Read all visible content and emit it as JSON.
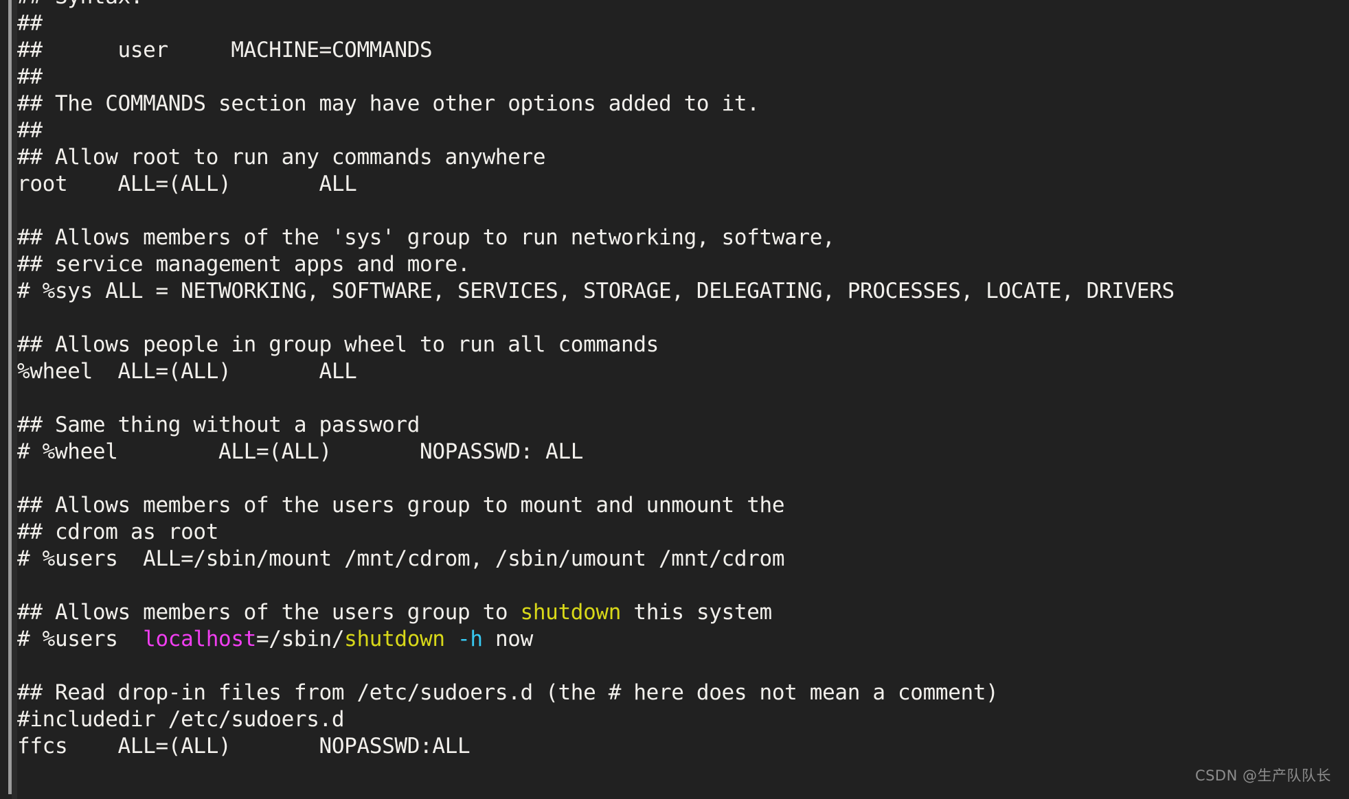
{
  "window": {
    "kind": "terminal-text-editor",
    "file_context": "/etc/sudoers",
    "background_color": "#212121",
    "foreground_color": "#f2f0ec"
  },
  "colors": {
    "default": "#f2f0ec",
    "keyword_yellow": "#d8d819",
    "host_magenta": "#f03ef0",
    "flag_cyan": "#37c9f2",
    "scrollbar": "#9b9b9b",
    "watermark": "#8d8d8d"
  },
  "editor": {
    "lines": [
      {
        "id": 1,
        "segments": [
          {
            "text": "## Syntax:",
            "color": "default"
          }
        ]
      },
      {
        "id": 2,
        "segments": [
          {
            "text": "##",
            "color": "default"
          }
        ]
      },
      {
        "id": 3,
        "segments": [
          {
            "text": "##      user     MACHINE=COMMANDS",
            "color": "default"
          }
        ]
      },
      {
        "id": 4,
        "segments": [
          {
            "text": "##",
            "color": "default"
          }
        ]
      },
      {
        "id": 5,
        "segments": [
          {
            "text": "## The COMMANDS section may have other options added to it.",
            "color": "default"
          }
        ]
      },
      {
        "id": 6,
        "segments": [
          {
            "text": "##",
            "color": "default"
          }
        ]
      },
      {
        "id": 7,
        "segments": [
          {
            "text": "## Allow root to run any commands anywhere",
            "color": "default"
          }
        ]
      },
      {
        "id": 8,
        "segments": [
          {
            "text": "root    ALL=(ALL)       ALL",
            "color": "default"
          }
        ]
      },
      {
        "id": 9,
        "segments": [
          {
            "text": "",
            "color": "default"
          }
        ]
      },
      {
        "id": 10,
        "segments": [
          {
            "text": "## Allows members of the 'sys' group to run networking, software,",
            "color": "default"
          }
        ]
      },
      {
        "id": 11,
        "segments": [
          {
            "text": "## service management apps and more.",
            "color": "default"
          }
        ]
      },
      {
        "id": 12,
        "segments": [
          {
            "text": "# %sys ALL = NETWORKING, SOFTWARE, SERVICES, STORAGE, DELEGATING, PROCESSES, LOCATE, DRIVERS",
            "color": "default"
          }
        ]
      },
      {
        "id": 13,
        "segments": [
          {
            "text": "",
            "color": "default"
          }
        ]
      },
      {
        "id": 14,
        "segments": [
          {
            "text": "## Allows people in group wheel to run all commands",
            "color": "default"
          }
        ]
      },
      {
        "id": 15,
        "segments": [
          {
            "text": "%wheel  ALL=(ALL)       ALL",
            "color": "default"
          }
        ]
      },
      {
        "id": 16,
        "segments": [
          {
            "text": "",
            "color": "default"
          }
        ]
      },
      {
        "id": 17,
        "segments": [
          {
            "text": "## Same thing without a password",
            "color": "default"
          }
        ]
      },
      {
        "id": 18,
        "segments": [
          {
            "text": "# %wheel        ALL=(ALL)       NOPASSWD: ALL",
            "color": "default"
          }
        ]
      },
      {
        "id": 19,
        "segments": [
          {
            "text": "",
            "color": "default"
          }
        ]
      },
      {
        "id": 20,
        "segments": [
          {
            "text": "## Allows members of the users group to mount and unmount the",
            "color": "default"
          }
        ]
      },
      {
        "id": 21,
        "segments": [
          {
            "text": "## cdrom as root",
            "color": "default"
          }
        ]
      },
      {
        "id": 22,
        "segments": [
          {
            "text": "# %users  ALL=/sbin/mount /mnt/cdrom, /sbin/umount /mnt/cdrom",
            "color": "default"
          }
        ]
      },
      {
        "id": 23,
        "segments": [
          {
            "text": "",
            "color": "default"
          }
        ]
      },
      {
        "id": 24,
        "segments": [
          {
            "text": "## Allows members of the users group to ",
            "color": "default"
          },
          {
            "text": "shutdown",
            "color": "keyword_yellow"
          },
          {
            "text": " this system",
            "color": "default"
          }
        ]
      },
      {
        "id": 25,
        "segments": [
          {
            "text": "# %users  ",
            "color": "default"
          },
          {
            "text": "localhost",
            "color": "host_magenta"
          },
          {
            "text": "=/sbin/",
            "color": "default"
          },
          {
            "text": "shutdown",
            "color": "keyword_yellow"
          },
          {
            "text": " ",
            "color": "default"
          },
          {
            "text": "-h",
            "color": "flag_cyan"
          },
          {
            "text": " now",
            "color": "default"
          }
        ]
      },
      {
        "id": 26,
        "segments": [
          {
            "text": "",
            "color": "default"
          }
        ]
      },
      {
        "id": 27,
        "segments": [
          {
            "text": "## Read drop-in files from /etc/sudoers.d (the # here does not mean a comment)",
            "color": "default"
          }
        ]
      },
      {
        "id": 28,
        "segments": [
          {
            "text": "#includedir /etc/sudoers.d",
            "color": "default"
          }
        ]
      },
      {
        "id": 29,
        "segments": [
          {
            "text": "ffcs    ALL=(ALL)       NOPASSWD:ALL",
            "color": "default"
          }
        ]
      }
    ]
  },
  "watermark": {
    "text": "CSDN @生产队队长"
  }
}
